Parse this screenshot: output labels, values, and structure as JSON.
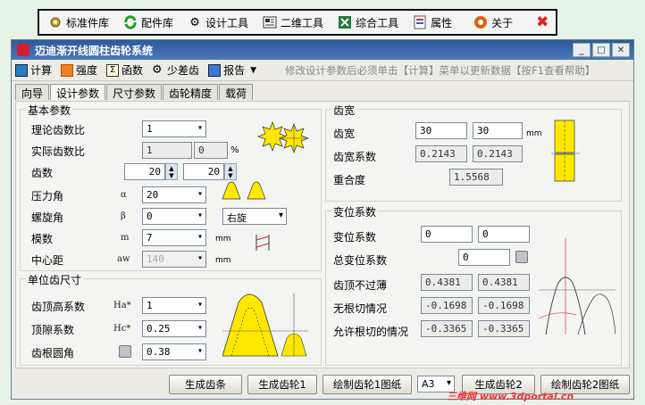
{
  "top_toolbar": {
    "items": [
      {
        "label": "标准件库"
      },
      {
        "label": "配件库"
      },
      {
        "label": "设计工具"
      },
      {
        "label": "二维工具"
      },
      {
        "label": "综合工具"
      },
      {
        "label": "属性"
      },
      {
        "label": "关于"
      }
    ]
  },
  "window": {
    "title": "迈迪渐开线圆柱齿轮系统"
  },
  "menubar": {
    "calc": "计算",
    "strength": "强度",
    "function": "函数",
    "few_teeth": "少差齿",
    "report": "报告",
    "hint": "修改设计参数后必须单击【计算】菜单以更新数据【按F1查看帮助】"
  },
  "tabs": [
    "向导",
    "设计参数",
    "尺寸参数",
    "齿轮精度",
    "载荷"
  ],
  "basic": {
    "title": "基本参数",
    "theory_ratio_label": "理论齿数比",
    "theory_ratio_value": "1",
    "actual_ratio_label": "实际齿数比",
    "actual_ratio_value": "1",
    "actual_ratio_value2": "0",
    "percent": "%",
    "teeth_label": "齿数",
    "teeth1": "20",
    "teeth2": "20",
    "pressure_label": "压力角",
    "pressure_sym": "α",
    "pressure_value": "20",
    "helix_label": "螺旋角",
    "helix_sym": "β",
    "helix_value": "0",
    "helix_dir": "右旋",
    "module_label": "模数",
    "module_sym": "m",
    "module_value": "7",
    "module_unit": "mm",
    "center_label": "中心距",
    "center_sym": "aw",
    "center_value": "140",
    "center_unit": "mm"
  },
  "unit_tooth": {
    "title": "单位齿尺寸",
    "addendum_label": "齿顶高系数",
    "addendum_sym": "Ha*",
    "addendum_value": "1",
    "clearance_label": "顶隙系数",
    "clearance_sym": "Hc*",
    "clearance_value": "0.25",
    "fillet_label": "齿根圆角",
    "fillet_value": "0.38"
  },
  "face_width": {
    "title": "齿宽",
    "width_label": "齿宽",
    "width1": "30",
    "width2": "30",
    "width_unit": "mm",
    "coef_label": "齿宽系数",
    "coef1": "0.2143",
    "coef2": "0.2143",
    "overlap_label": "重合度",
    "overlap_value": "1.5568"
  },
  "shift": {
    "title": "变位系数",
    "shift_label": "变位系数",
    "shift1": "0",
    "shift2": "0",
    "total_label": "总变位系数",
    "total_value": "0",
    "tip_label": "齿顶不过薄",
    "tip1": "0.4381",
    "tip2": "0.4381",
    "undercut_label": "无根切情况",
    "undercut1": "-0.1698",
    "undercut2": "-0.1698",
    "allow_label": "允许根切的情况",
    "allow1": "-0.3365",
    "allow2": "-0.3365"
  },
  "bottom": {
    "gen_rack": "生成齿条",
    "gen_gear1": "生成齿轮1",
    "draw_gear1": "绘制齿轮1图纸",
    "paper": "A3",
    "gen_gear2": "生成齿轮2",
    "draw_gear2": "绘制齿轮2图纸"
  },
  "watermark": "三维网 www.3dportal.cn",
  "colors": {
    "title_bar": "#3a67a8",
    "gear_yellow": "#ffe800",
    "close_red": "#e0201a"
  }
}
